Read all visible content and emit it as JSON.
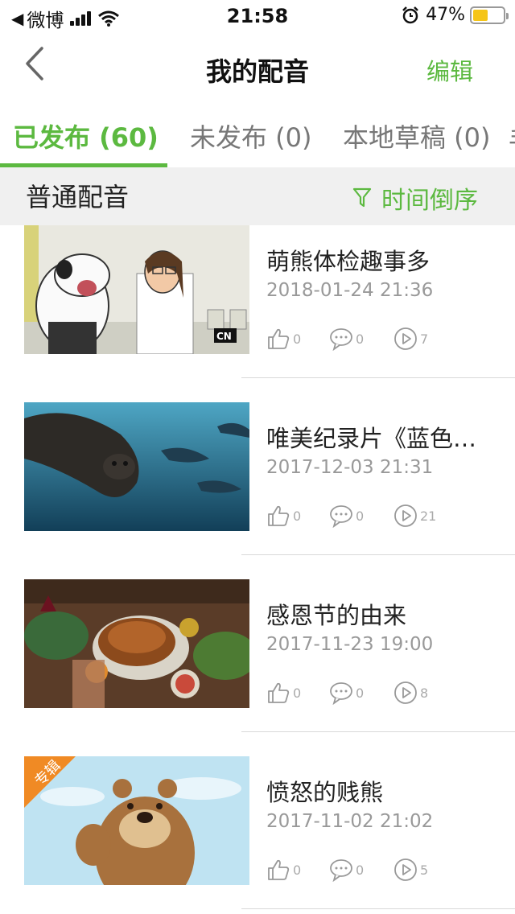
{
  "status_bar": {
    "carrier": "微博",
    "time": "21:58",
    "battery": "47%"
  },
  "nav": {
    "title": "我的配音",
    "edit_label": "编辑"
  },
  "tabs": [
    {
      "label": "已发布 (60)"
    },
    {
      "label": "未发布 (0)"
    },
    {
      "label": "本地草稿 (0)"
    }
  ],
  "filter": {
    "title": "普通配音",
    "sort_label": "时间倒序"
  },
  "items": [
    {
      "title": "萌熊体检趣事多",
      "date": "2018-01-24 21:36",
      "likes": "0",
      "comments": "0",
      "plays": "7"
    },
    {
      "title": "唯美纪录片《蓝色星球》",
      "date": "2017-12-03 21:31",
      "likes": "0",
      "comments": "0",
      "plays": "21"
    },
    {
      "title": "感恩节的由来",
      "date": "2017-11-23 19:00",
      "likes": "0",
      "comments": "0",
      "plays": "8"
    },
    {
      "title": "愤怒的贱熊",
      "date": "2017-11-02 21:02",
      "likes": "0",
      "comments": "0",
      "plays": "5",
      "tag": "专辑"
    }
  ],
  "colors": {
    "accent": "#5cb940",
    "muted_text": "#999999",
    "filter_bg": "#f0f0f0",
    "album_tag": "#f08a24"
  }
}
